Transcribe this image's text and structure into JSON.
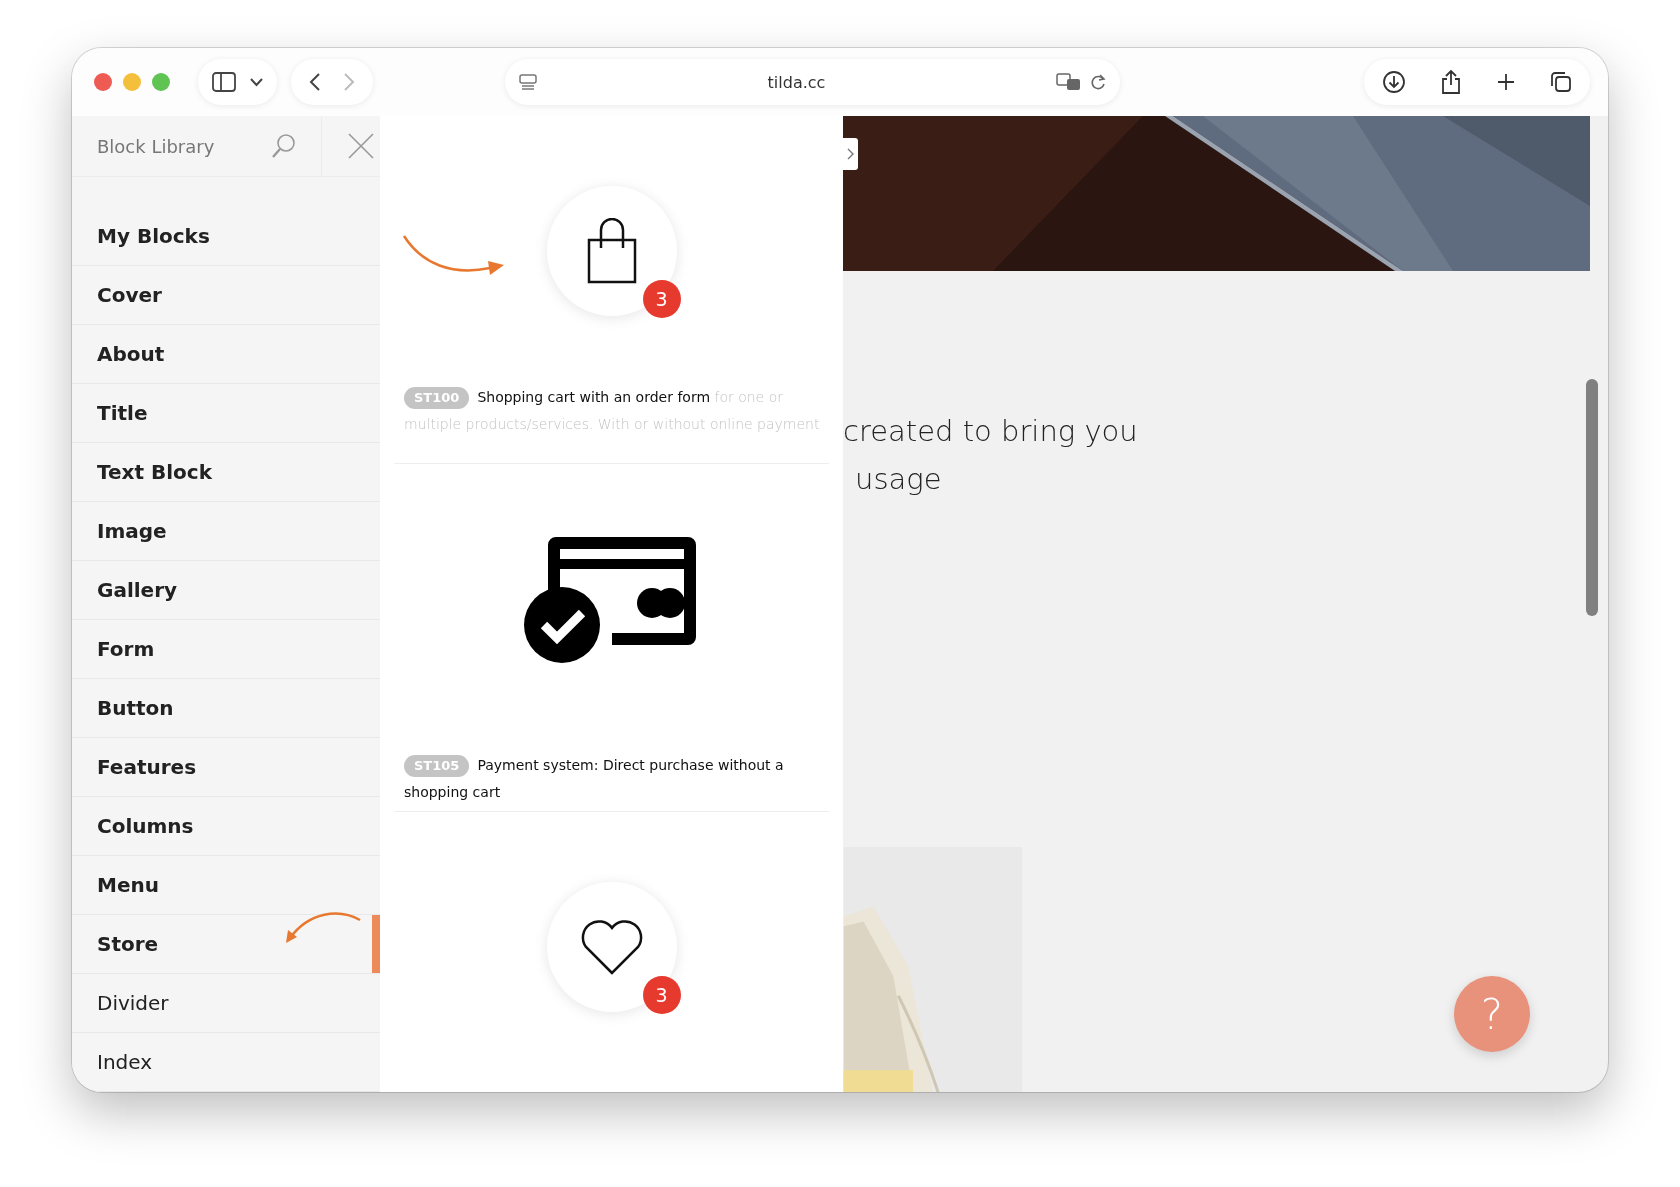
{
  "browser": {
    "url": "tilda.cc"
  },
  "library": {
    "title": "Block Library",
    "categories": [
      {
        "label": "My Blocks",
        "bold": true,
        "selected": false
      },
      {
        "label": "Cover",
        "bold": true,
        "selected": false
      },
      {
        "label": "About",
        "bold": true,
        "selected": false
      },
      {
        "label": "Title",
        "bold": true,
        "selected": false
      },
      {
        "label": "Text Block",
        "bold": true,
        "selected": false
      },
      {
        "label": "Image",
        "bold": true,
        "selected": false
      },
      {
        "label": "Gallery",
        "bold": true,
        "selected": false
      },
      {
        "label": "Form",
        "bold": true,
        "selected": false
      },
      {
        "label": "Button",
        "bold": true,
        "selected": false
      },
      {
        "label": "Features",
        "bold": true,
        "selected": false
      },
      {
        "label": "Columns",
        "bold": true,
        "selected": false
      },
      {
        "label": "Menu",
        "bold": true,
        "selected": false
      },
      {
        "label": "Store",
        "bold": true,
        "selected": true
      },
      {
        "label": "Divider",
        "bold": false,
        "selected": false
      },
      {
        "label": "Index",
        "bold": false,
        "selected": false
      }
    ]
  },
  "blocks": [
    {
      "kind": "bag",
      "badge": "3",
      "code": "ST100",
      "title": "Shopping cart with an order form",
      "description": "for one or multiple products/services. With or without online payment"
    },
    {
      "kind": "card",
      "code": "ST105",
      "title": "Payment system: Direct purchase without a shopping cart"
    },
    {
      "kind": "heart",
      "badge": "3"
    }
  ],
  "page": {
    "text_lines": [
      "created to bring you",
      "usage"
    ],
    "help_button": "?"
  }
}
